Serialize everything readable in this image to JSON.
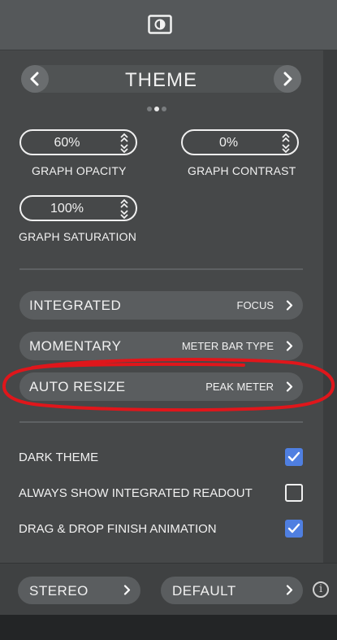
{
  "header": {
    "icon": "brightness-contrast-icon"
  },
  "theme_nav": {
    "title": "THEME",
    "prev_icon": "chevron-left-icon",
    "next_icon": "chevron-right-icon",
    "page_dots": 3,
    "active_dot": 1
  },
  "graph_settings": [
    {
      "value": "60%",
      "label": "GRAPH OPACITY"
    },
    {
      "value": "0%",
      "label": "GRAPH CONTRAST"
    },
    {
      "value": "100%",
      "label": "GRAPH SATURATION"
    }
  ],
  "option_rows": [
    {
      "label": "INTEGRATED",
      "value": "FOCUS"
    },
    {
      "label": "MOMENTARY",
      "value": "METER BAR TYPE"
    },
    {
      "label": "AUTO RESIZE",
      "value": "PEAK METER"
    }
  ],
  "checkboxes": [
    {
      "label": "DARK THEME",
      "checked": true
    },
    {
      "label": "ALWAYS SHOW INTEGRATED READOUT",
      "checked": false
    },
    {
      "label": "DRAG & DROP FINISH ANIMATION",
      "checked": true
    }
  ],
  "bottom": {
    "left_button": "STEREO",
    "right_button": "DEFAULT",
    "info_icon": "info-icon",
    "info_glyph": "i"
  },
  "annotation": {
    "color": "#e0161b",
    "shape": "hand-drawn-ellipse"
  },
  "colors": {
    "accent": "#4f7fe1",
    "background": "#464849"
  }
}
